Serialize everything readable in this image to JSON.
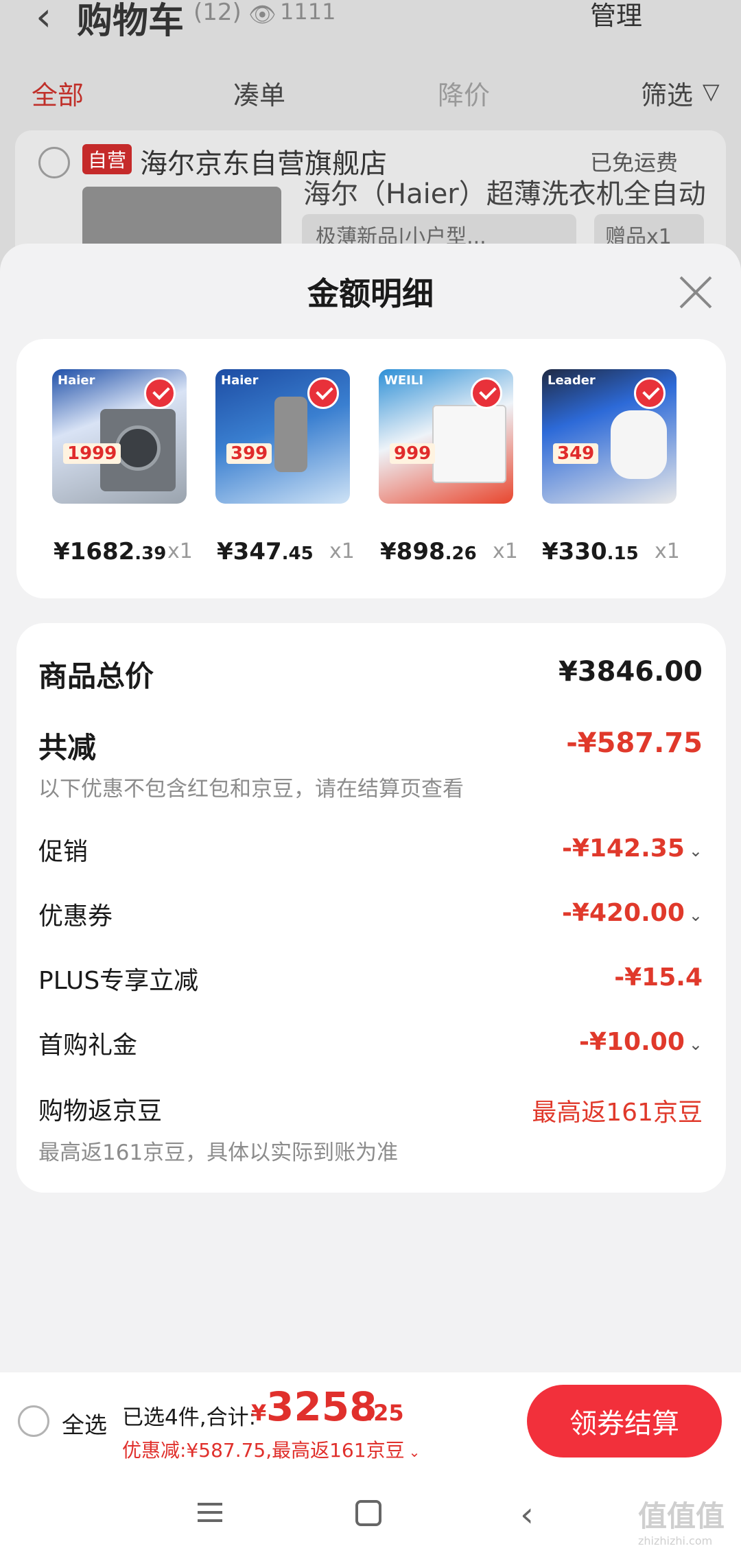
{
  "background": {
    "back_icon": "‹",
    "title": "购物车",
    "count": "(12)",
    "views_icon": "eye-icon",
    "views": "1111",
    "manage": "管理",
    "tabs": [
      "全部",
      "凑单",
      "降价",
      "筛选"
    ],
    "store": {
      "self_badge": "自营",
      "name": "海尔京东自营旗舰店",
      "free_shipping": "已免运费",
      "product_title": "海尔（Haier）超薄洗衣机全自动",
      "spec": "极薄新品|小户型...",
      "gift": "赠品x1"
    }
  },
  "sheet": {
    "title": "金额明细",
    "items": [
      {
        "brand": "Haier",
        "tag": "1999",
        "price_int": "¥1682",
        "price_dec": ".39",
        "qty": "x1"
      },
      {
        "brand": "Haier",
        "tag": "399",
        "price_int": "¥347",
        "price_dec": ".45",
        "qty": "x1"
      },
      {
        "brand": "WEILI",
        "tag": "999",
        "price_int": "¥898",
        "price_dec": ".26",
        "qty": "x1"
      },
      {
        "brand": "Leader",
        "tag": "349",
        "price_int": "¥330",
        "price_dec": ".15",
        "qty": "x1"
      }
    ],
    "total_label": "商品总价",
    "total_value": "¥3846.00",
    "reduce_label": "共减",
    "reduce_value": "-¥587.75",
    "reduce_note": "以下优惠不包含红包和京豆，请在结算页查看",
    "rows": [
      {
        "label": "促销",
        "value": "-¥142.35"
      },
      {
        "label": "优惠券",
        "value": "-¥420.00"
      },
      {
        "label": "PLUS专享立减",
        "value": "-¥15.4"
      },
      {
        "label": "首购礼金",
        "value": "-¥10.00"
      }
    ],
    "beans_label": "购物返京豆",
    "beans_value": "最高返161京豆",
    "beans_note": "最高返161京豆，具体以实际到账为准"
  },
  "checkout": {
    "select_all": "全选",
    "selected": "已选4件,合计:",
    "currency": "¥",
    "total_int": "3258",
    "total_dec": ".25",
    "discount": "优惠减:¥587.75,最高返161京豆",
    "button": "领券结算"
  },
  "watermark": {
    "text": "值值值",
    "url": "zhizhizhi.com"
  },
  "colors": {
    "accent": "#f2303b",
    "price_red": "#e0392b",
    "sheet_bg": "#f2f2f3"
  }
}
